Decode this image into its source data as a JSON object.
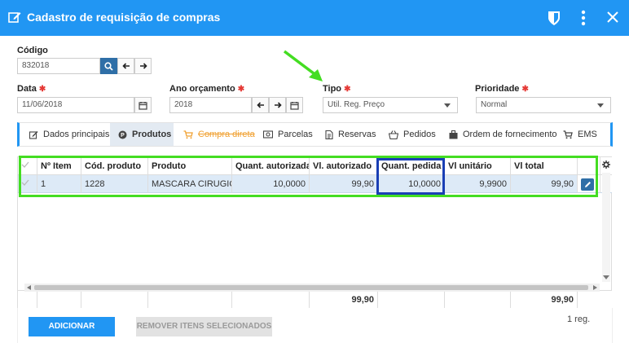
{
  "window": {
    "title": "Cadastro de requisição de compras"
  },
  "form": {
    "codigo_label": "Código",
    "codigo_value": "832018",
    "data_label": "Data",
    "data_value": "11/06/2018",
    "ano_label": "Ano orçamento",
    "ano_value": "2018",
    "tipo_label": "Tipo",
    "tipo_value": "Util. Reg. Preço",
    "prioridade_label": "Prioridade",
    "prioridade_value": "Normal",
    "required_mark": "✱"
  },
  "tabs": [
    {
      "label": "Dados principais"
    },
    {
      "label": "Produtos"
    },
    {
      "label": "Compra direta"
    },
    {
      "label": "Parcelas"
    },
    {
      "label": "Reservas"
    },
    {
      "label": "Pedidos"
    },
    {
      "label": "Ordem de fornecimento"
    },
    {
      "label": "EMS"
    }
  ],
  "grid": {
    "columns": [
      "Nº Item",
      "Cód. produto",
      "Produto",
      "Quant. autorizada",
      "Vl. autorizado",
      "Quant. pedida",
      "Vl unitário",
      "Vl total"
    ],
    "rows": [
      {
        "item": "1",
        "cod": "1228",
        "produto": "MASCARA CIRUGICA",
        "qautorizada": "10,0000",
        "vlautorizado": "99,90",
        "qpedida": "10,0000",
        "vlunit": "9,9900",
        "vltotal": "99,90"
      }
    ],
    "footer": {
      "vlautorizado": "99,90",
      "vltotal": "99,90"
    }
  },
  "actions": {
    "add_label": "ADICIONAR",
    "remove_label": "REMOVER ITENS SELECIONADOS",
    "count_label": "1 reg."
  },
  "colors": {
    "brand": "#2196f3",
    "highlight_green": "#44dd22",
    "highlight_blue": "#1a3fb5",
    "required": "#e53935"
  }
}
